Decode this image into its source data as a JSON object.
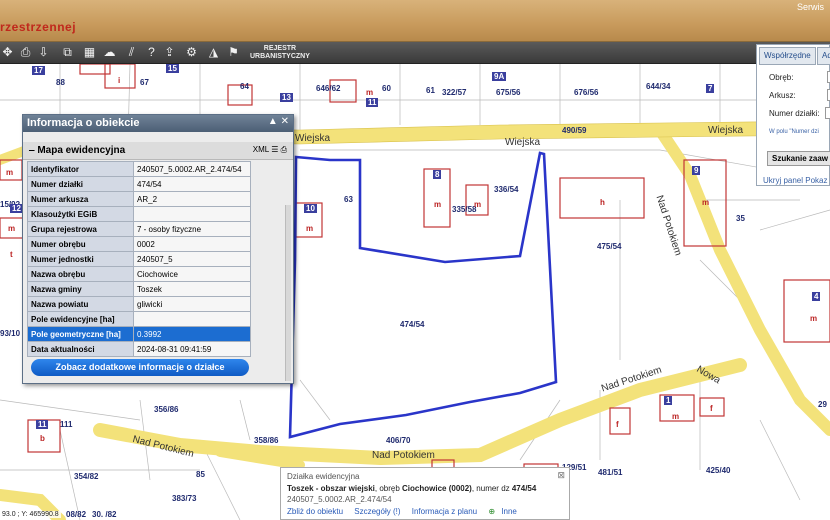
{
  "header": {
    "brand": "rzestrzennej",
    "serwis": "Serwis"
  },
  "toolbar": {
    "icons": [
      "pan-icon",
      "print-icon",
      "download-icon",
      "export-icon",
      "layout-icon",
      "cloud-icon",
      "hatch-icon",
      "help-icon",
      "upload-icon",
      "settings-icon",
      "ruler-icon",
      "pin-icon"
    ],
    "rejestr": "REJESTR\nURBANISTYCZNY"
  },
  "info_panel": {
    "title": "Informacja o obiekcie",
    "section": "Mapa ewidencyjna",
    "xml_label": "XML",
    "rows": [
      {
        "key": "Identyfikator",
        "value": "240507_5.0002.AR_2.474/54"
      },
      {
        "key": "Numer działki",
        "value": "474/54"
      },
      {
        "key": "Numer arkusza",
        "value": "AR_2"
      },
      {
        "key": "Klasoużytki EGiB",
        "value": ""
      },
      {
        "key": "Grupa rejestrowa",
        "value": "7 - osoby fizyczne"
      },
      {
        "key": "Numer obrębu",
        "value": "0002"
      },
      {
        "key": "Numer jednostki",
        "value": "240507_5"
      },
      {
        "key": "Nazwa obrębu",
        "value": "Ciochowice"
      },
      {
        "key": "Nazwa gminy",
        "value": "Toszek"
      },
      {
        "key": "Nazwa powiatu",
        "value": "gliwicki"
      },
      {
        "key": "Pole ewidencyjne [ha]",
        "value": ""
      },
      {
        "key": "Pole geometryczne [ha]",
        "value": "0.3992"
      },
      {
        "key": "Data aktualności",
        "value": "2024-08-31 09:41:59"
      }
    ],
    "button": "Zobacz dodatkowe informacje o działce"
  },
  "search_panel": {
    "tab1": "Współrzędne",
    "tab2": "Ad",
    "field1": "Obręb:",
    "field2": "Arkusz:",
    "field3": "Numer działki:",
    "note": "W polu \"Numer dzi",
    "button": "Szukanie zaaw",
    "links": "Ukryj panel   Pokaz"
  },
  "popup": {
    "title": "Działka ewidencyjna",
    "line2_bold": "Toszek - obszar wiejski",
    "line2_rest": ", obręb ",
    "line2_obreb": "Ciochowice (0002)",
    "line2_num_label": ", numer dz ",
    "line2_num": "474/54",
    "line3": "240507_5.0002.AR_2.474/54",
    "links": [
      "Zbliż do obiektu",
      "Szczegóły (!)",
      "Informacja z planu",
      "Inne"
    ]
  },
  "coords": "93.0 ; Y: 465990.8",
  "map": {
    "streets": [
      "Wiejska",
      "Wiejska",
      "Wiejska",
      "Nad Potokiem",
      "Nad Potokiem",
      "Nad Potokiem",
      "Nad Potokiem",
      "Nowa"
    ],
    "parcels": [
      "88",
      "67",
      "64",
      "646/62",
      "60",
      "61",
      "322/57",
      "675/56",
      "676/56",
      "644/34",
      "490/59",
      "63",
      "335/58",
      "336/54",
      "475/54",
      "35",
      "474/54",
      "356/86",
      "358/86",
      "406/70",
      "481/51",
      "425/40",
      "354/82",
      "383/73",
      "85",
      "29",
      "111",
      "15/92",
      "93/10",
      "08/82",
      "30. /82",
      "129/51"
    ],
    "buildings": [
      "17",
      "15",
      "13",
      "11",
      "9A",
      "7",
      "12",
      "8",
      "10",
      "9",
      "4",
      "1",
      "11",
      "i",
      "m",
      "m",
      "m",
      "m",
      "h",
      "m",
      "m",
      "m",
      "b",
      "m",
      "m",
      "m",
      "f",
      "f",
      "t"
    ]
  }
}
